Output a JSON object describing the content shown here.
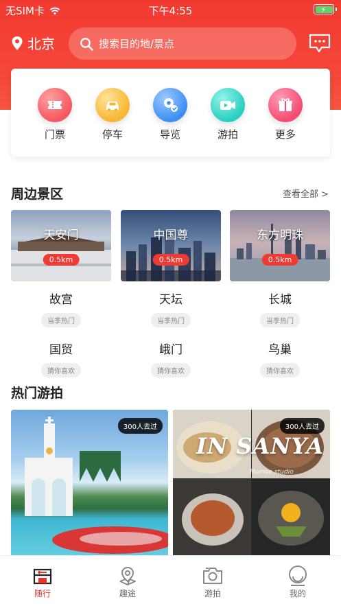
{
  "status_bar": {
    "carrier": "无SIM卡",
    "time": "下午4:55"
  },
  "header": {
    "city": "北京",
    "search_placeholder": "搜索目的地/景点"
  },
  "categories": [
    {
      "label": "门票",
      "icon": "ticket-icon",
      "color": "#f5575f"
    },
    {
      "label": "停车",
      "icon": "car-icon",
      "color": "#f7b631"
    },
    {
      "label": "导览",
      "icon": "guide-icon",
      "color": "#3d8ef3"
    },
    {
      "label": "游拍",
      "icon": "video-icon",
      "color": "#27cfc1"
    },
    {
      "label": "更多",
      "icon": "gift-icon",
      "color": "#f44a73"
    }
  ],
  "nearby": {
    "title": "周边景区",
    "see_all": "查看全部 >",
    "cards": [
      {
        "name": "天安门",
        "distance": "0.5km"
      },
      {
        "name": "中国尊",
        "distance": "0.5km"
      },
      {
        "name": "东方明珠",
        "distance": "0.5km"
      }
    ],
    "spots_row1": [
      {
        "name": "故宫",
        "tag": "当季热门"
      },
      {
        "name": "天坛",
        "tag": "当季热门"
      },
      {
        "name": "长城",
        "tag": "当季热门"
      }
    ],
    "spots_row2": [
      {
        "name": "国贸",
        "tag": "猜你喜欢"
      },
      {
        "name": "峨门",
        "tag": "猜你喜欢"
      },
      {
        "name": "鸟巢",
        "tag": "猜你喜欢"
      }
    ]
  },
  "hot": {
    "title": "热门游拍",
    "photos": [
      {
        "badge": "300人去过"
      },
      {
        "badge": "300人去过",
        "overlay": "IN SANYA",
        "studio": "Momoe studio"
      }
    ]
  },
  "tabbar": [
    {
      "label": "随行",
      "icon": "home-icon",
      "active": true
    },
    {
      "label": "趣途",
      "icon": "map-pin-icon",
      "active": false
    },
    {
      "label": "游拍",
      "icon": "camera-icon",
      "active": false
    },
    {
      "label": "我的",
      "icon": "profile-icon",
      "active": false
    }
  ]
}
